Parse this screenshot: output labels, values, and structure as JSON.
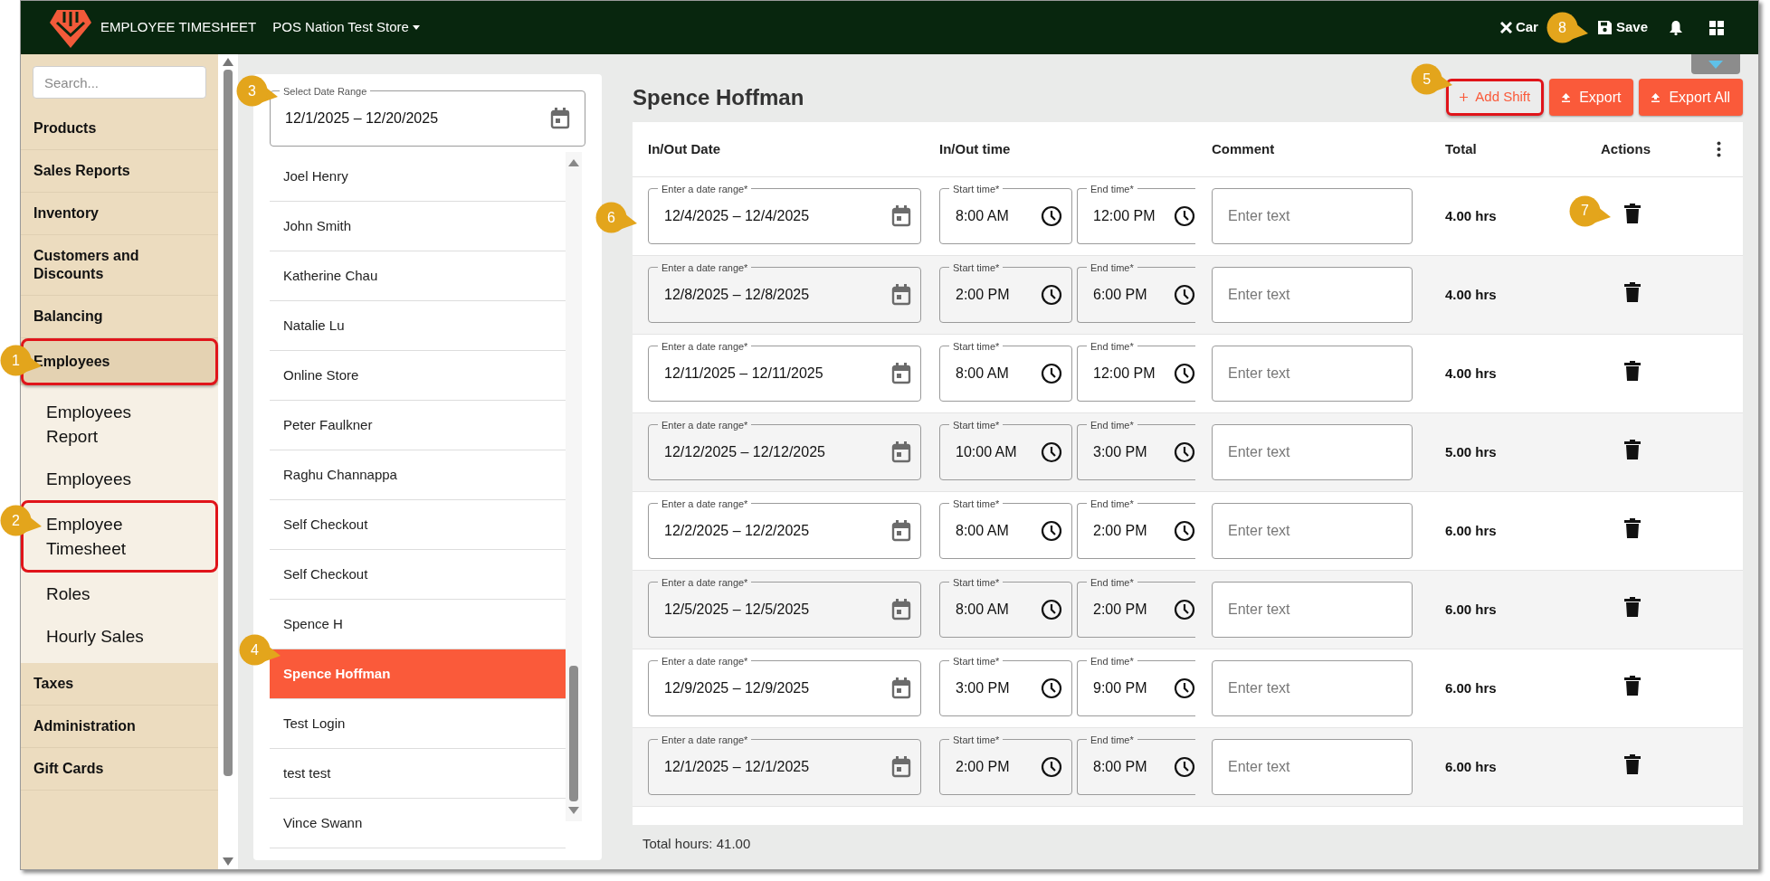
{
  "top_bar": {
    "app_title": "EMPLOYEE TIMESHEET",
    "store": "POS Nation Test Store",
    "actions": [
      {
        "kind": "cancel",
        "label": "Car"
      },
      {
        "kind": "save",
        "label": "Save",
        "callout": "8"
      },
      {
        "kind": "notifications"
      },
      {
        "kind": "apps"
      }
    ]
  },
  "sidebar": {
    "search_placeholder": "Search...",
    "items": [
      {
        "label": "Products",
        "highlighted": false
      },
      {
        "label": "Sales Reports",
        "highlighted": false
      },
      {
        "label": "Inventory",
        "highlighted": false
      },
      {
        "label": "Customers and Discounts",
        "highlighted": false
      },
      {
        "label": "Balancing",
        "highlighted": false
      },
      {
        "label": "Employees",
        "highlighted": true,
        "callout": "1",
        "expanded": true,
        "children": [
          {
            "label": "Employees Report",
            "highlighted": false
          },
          {
            "label": "Employees",
            "highlighted": false
          },
          {
            "label": "Employee Timesheet",
            "highlighted": true,
            "callout": "2"
          },
          {
            "label": "Roles",
            "highlighted": false
          },
          {
            "label": "Hourly Sales",
            "highlighted": false
          }
        ]
      },
      {
        "label": "Taxes",
        "highlighted": false
      },
      {
        "label": "Administration",
        "highlighted": false
      },
      {
        "label": "Gift Cards",
        "highlighted": false
      }
    ]
  },
  "collapse_toggle": {
    "expanded": false
  },
  "date_range": {
    "label": "Select Date Range",
    "value": "12/1/2025 – 12/20/2025",
    "callout": "3"
  },
  "employees": [
    {
      "name": "Joel Henry",
      "selected": false
    },
    {
      "name": "John Smith",
      "selected": false
    },
    {
      "name": "Katherine Chau",
      "selected": false
    },
    {
      "name": "Natalie Lu",
      "selected": false
    },
    {
      "name": "Online Store",
      "selected": false
    },
    {
      "name": "Peter Faulkner",
      "selected": false
    },
    {
      "name": "Raghu Channappa",
      "selected": false
    },
    {
      "name": "Self Checkout",
      "selected": false
    },
    {
      "name": "Self Checkout",
      "selected": false
    },
    {
      "name": "Spence H",
      "selected": false
    },
    {
      "name": "Spence Hoffman",
      "selected": true,
      "callout": "4"
    },
    {
      "name": "Test Login",
      "selected": false
    },
    {
      "name": "test test",
      "selected": false
    },
    {
      "name": "Vince Swann",
      "selected": false
    }
  ],
  "main": {
    "title": "Spence Hoffman",
    "buttons": [
      {
        "kind": "add",
        "label": "Add Shift",
        "highlighted": true,
        "callout": "5"
      },
      {
        "kind": "export",
        "label": "Export",
        "highlighted": false
      },
      {
        "kind": "export",
        "label": "Export All",
        "highlighted": false
      }
    ],
    "table": {
      "columns": [
        "In/Out Date",
        "In/Out time",
        "Comment",
        "Total",
        "Actions"
      ],
      "rows": [
        {
          "date_label": "Enter a date range*",
          "date": "12/4/2025 – 12/4/2025",
          "start_label": "Start time*",
          "start": "8:00 AM",
          "end_label": "End time*",
          "end": "12:00 PM",
          "comment_placeholder": "Enter text",
          "total": "4.00 hrs",
          "callout": "6",
          "delete_callout": "7"
        },
        {
          "date_label": "Enter a date range*",
          "date": "12/8/2025 – 12/8/2025",
          "start_label": "Start time*",
          "start": "2:00 PM",
          "end_label": "End time*",
          "end": "6:00 PM",
          "comment_placeholder": "Enter text",
          "total": "4.00 hrs"
        },
        {
          "date_label": "Enter a date range*",
          "date": "12/11/2025 – 12/11/2025",
          "start_label": "Start time*",
          "start": "8:00 AM",
          "end_label": "End time*",
          "end": "12:00 PM",
          "comment_placeholder": "Enter text",
          "total": "4.00 hrs"
        },
        {
          "date_label": "Enter a date range*",
          "date": "12/12/2025 – 12/12/2025",
          "start_label": "Start time*",
          "start": "10:00 AM",
          "end_label": "End time*",
          "end": "3:00 PM",
          "comment_placeholder": "Enter text",
          "total": "5.00 hrs"
        },
        {
          "date_label": "Enter a date range*",
          "date": "12/2/2025 – 12/2/2025",
          "start_label": "Start time*",
          "start": "8:00 AM",
          "end_label": "End time*",
          "end": "2:00 PM",
          "comment_placeholder": "Enter text",
          "total": "6.00 hrs"
        },
        {
          "date_label": "Enter a date range*",
          "date": "12/5/2025 – 12/5/2025",
          "start_label": "Start time*",
          "start": "8:00 AM",
          "end_label": "End time*",
          "end": "2:00 PM",
          "comment_placeholder": "Enter text",
          "total": "6.00 hrs"
        },
        {
          "date_label": "Enter a date range*",
          "date": "12/9/2025 – 12/9/2025",
          "start_label": "Start time*",
          "start": "3:00 PM",
          "end_label": "End time*",
          "end": "9:00 PM",
          "comment_placeholder": "Enter text",
          "total": "6.00 hrs"
        },
        {
          "date_label": "Enter a date range*",
          "date": "12/1/2025 – 12/1/2025",
          "start_label": "Start time*",
          "start": "2:00 PM",
          "end_label": "End time*",
          "end": "8:00 PM",
          "comment_placeholder": "Enter text",
          "total": "6.00 hrs"
        }
      ]
    },
    "total_hours": "Total hours: 41.00"
  }
}
